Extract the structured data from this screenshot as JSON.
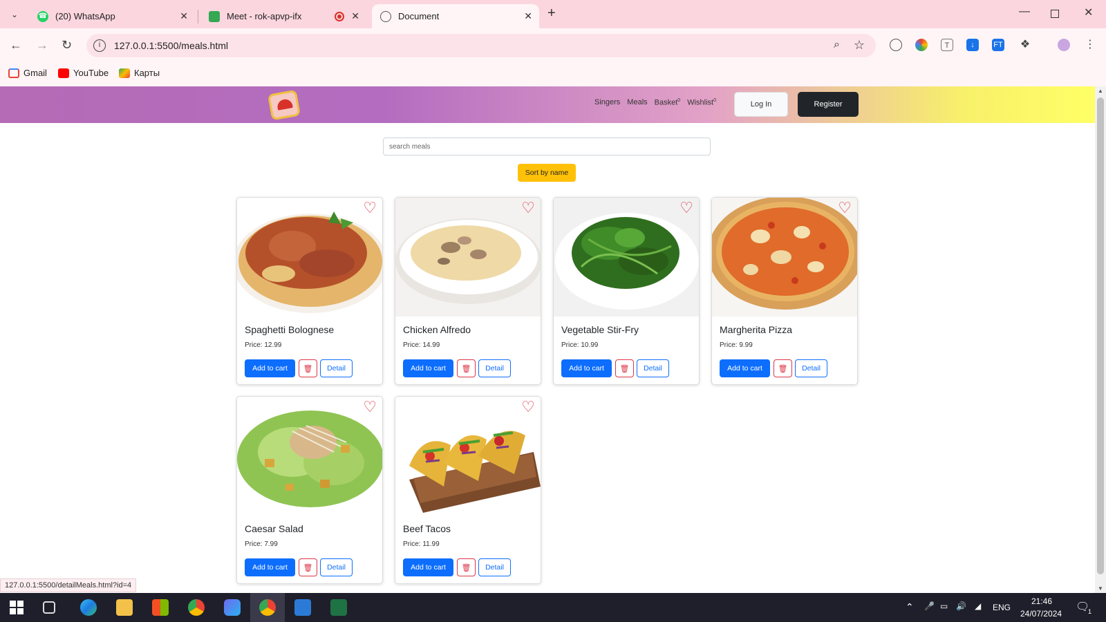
{
  "browser": {
    "tabs": [
      {
        "title": "(20) WhatsApp",
        "icon": "whatsapp-icon"
      },
      {
        "title": "Meet - rok-apvp-ifx",
        "icon": "google-meet-icon"
      },
      {
        "title": "Document",
        "icon": "globe-icon"
      }
    ],
    "url": "127.0.0.1:5500/meals.html",
    "bookmarks": [
      {
        "label": "Gmail",
        "icon": "gmail-icon"
      },
      {
        "label": "YouTube",
        "icon": "youtube-icon"
      },
      {
        "label": "Карты",
        "icon": "maps-icon"
      }
    ],
    "status_url": "127.0.0.1:5500/detailMeals.html?id=4"
  },
  "site": {
    "nav": [
      {
        "label": "Singers",
        "count": ""
      },
      {
        "label": "Meals",
        "count": ""
      },
      {
        "label": "Basket",
        "count": "0"
      },
      {
        "label": "Wishlist",
        "count": "0"
      }
    ],
    "login_label": "Log In",
    "register_label": "Register",
    "search_placeholder": "search meals",
    "sort_label": "Sort by name"
  },
  "card_labels": {
    "price_prefix": "Price: ",
    "add_to_cart": "Add to cart",
    "trash_icon": "trash-icon",
    "detail": "Detail"
  },
  "meals": [
    {
      "name": "Spaghetti Bolognese",
      "price": "12.99"
    },
    {
      "name": "Chicken Alfredo",
      "price": "14.99"
    },
    {
      "name": "Vegetable Stir-Fry",
      "price": "10.99"
    },
    {
      "name": "Margherita Pizza",
      "price": "9.99"
    },
    {
      "name": "Caesar Salad",
      "price": "7.99"
    },
    {
      "name": "Beef Tacos",
      "price": "11.99"
    }
  ],
  "taskbar": {
    "lang": "ENG",
    "time": "21:46",
    "date": "24/07/2024",
    "notification_count": "1"
  },
  "colors": {
    "primary": "#0d6efd",
    "danger": "#dc3545",
    "warning": "#ffc107",
    "dark": "#212529"
  }
}
